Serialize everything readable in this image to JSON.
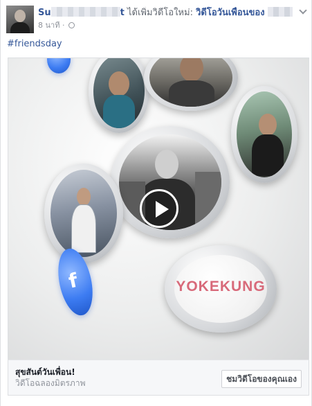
{
  "post": {
    "author_visible_start": "Su",
    "author_visible_end": "t",
    "action_text": "ได้เพิ่มวิดีโอใหม่:",
    "video_title": "วิดีโอวันเพื่อนของ",
    "timestamp": "8 นาที",
    "separator": "·",
    "hashtag": "#friendsday"
  },
  "media": {
    "logo_text": "YOKEKUNG"
  },
  "footer": {
    "title": "สุขสันต์วันเพื่อน!",
    "subtitle": "วิดีโอฉลองมิตรภาพ",
    "cta_label": "ชมวิดีโอของคุณเอง"
  },
  "icons": {
    "chevron": "chevron-down-icon",
    "privacy": "globe-icon",
    "play": "play-icon"
  },
  "colors": {
    "link_blue": "#365899",
    "accent_blue": "#3d7cf2",
    "logo_pink": "#d86a7a"
  }
}
